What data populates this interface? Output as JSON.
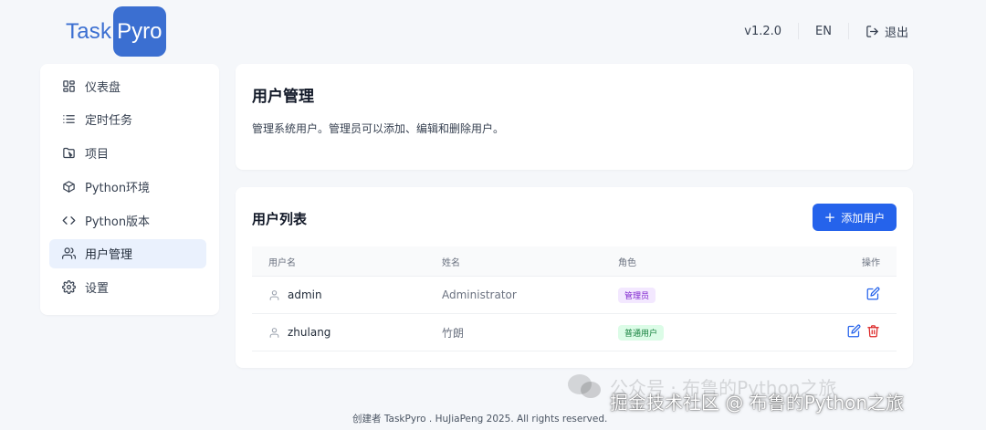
{
  "brand": {
    "part1": "Task",
    "part2": "Pyro",
    "color": "#3b6fd1"
  },
  "topbar": {
    "version": "v1.2.0",
    "language": "EN",
    "logout_label": "退出"
  },
  "sidebar": {
    "items": [
      {
        "label": "仪表盘",
        "icon": "dashboard-icon",
        "active": false
      },
      {
        "label": "定时任务",
        "icon": "list-icon",
        "active": false
      },
      {
        "label": "项目",
        "icon": "folder-icon",
        "active": false
      },
      {
        "label": "Python环境",
        "icon": "cube-icon",
        "active": false
      },
      {
        "label": "Python版本",
        "icon": "code-icon",
        "active": false
      },
      {
        "label": "用户管理",
        "icon": "users-icon",
        "active": true
      },
      {
        "label": "设置",
        "icon": "gear-icon",
        "active": false
      }
    ]
  },
  "page": {
    "title": "用户管理",
    "description": "管理系统用户。管理员可以添加、编辑和删除用户。"
  },
  "user_list": {
    "title": "用户列表",
    "add_button": "添加用户",
    "columns": [
      "用户名",
      "姓名",
      "角色",
      "操作"
    ],
    "rows": [
      {
        "username": "admin",
        "name": "Administrator",
        "role": "管理员",
        "role_type": "admin",
        "can_delete": false
      },
      {
        "username": "zhulang",
        "name": "竹朗",
        "role": "普通用户",
        "role_type": "user",
        "can_delete": true
      }
    ]
  },
  "footer": {
    "text": "创建者 TaskPyro . HuJiaPeng 2025. All rights reserved."
  },
  "watermark": {
    "line1": "公众号 · 布鲁的Python之旅",
    "line2": "掘金技术社区 @ 布鲁的Python之旅"
  },
  "colors": {
    "accent": "#2563eb",
    "active_bg": "#eaf1fd",
    "danger": "#dc2626"
  }
}
